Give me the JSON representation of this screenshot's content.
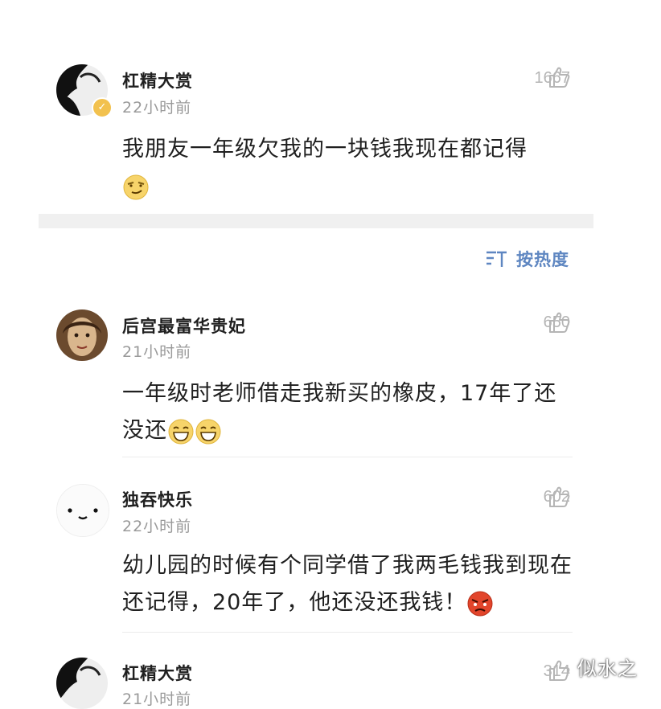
{
  "comments": [
    {
      "name": "杠精大赏",
      "time": "22小时前",
      "likes": "1667",
      "text": "我朋友一年级欠我的一块钱我现在都记得",
      "emoji": "smirk-emoji"
    },
    {
      "name": "后宫最富华贵妃",
      "time": "21小时前",
      "likes": "650",
      "text": "一年级时老师借走我新买的橡皮，17年了还没还",
      "emoji": "grin-emoji"
    },
    {
      "name": "独吞快乐",
      "time": "22小时前",
      "likes": "602",
      "text": "幼儿园的时候有个同学借了我两毛钱我到现在还记得，20年了，他还没还我钱！",
      "emoji": "angry-emoji"
    },
    {
      "name": "杠精大赏",
      "time": "21小时前",
      "likes": "314"
    }
  ],
  "sort": {
    "label": "按热度",
    "icon": "sort-icon"
  },
  "watermark": "似水之",
  "colors": {
    "accent": "#5e86c1",
    "like": "#b5b5b5",
    "time": "#9a9a9a"
  }
}
